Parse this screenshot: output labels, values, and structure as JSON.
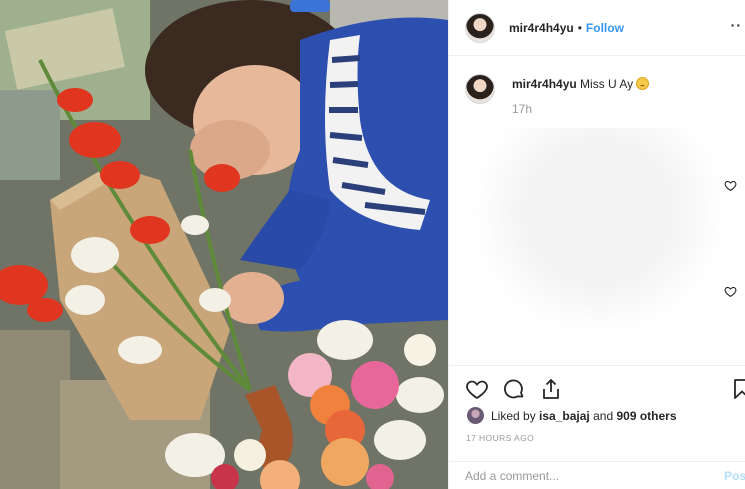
{
  "post": {
    "username": "mir4r4h4yu",
    "separator": "•",
    "follow_label": "Follow",
    "more_label": "··",
    "avatar_icon": "profile-avatar"
  },
  "comment": {
    "username": "mir4r4h4yu",
    "text": "Miss U Ay",
    "emoji_icon": "sad-face-emoji",
    "time": "17h"
  },
  "actions": {
    "like_icon": "heart-icon",
    "comment_icon": "comment-bubble-icon",
    "share_icon": "share-icon",
    "save_icon": "bookmark-icon",
    "liked_by_prefix": "Liked by ",
    "liked_by_user": "isa_bajaj",
    "liked_by_middle": " and ",
    "liked_by_count": "909 others",
    "timestamp": "17 HOURS AGO"
  },
  "composer": {
    "placeholder": "Add a comment...",
    "post_label": "Pos"
  },
  "colors": {
    "link_blue": "#3897f0",
    "post_disabled": "#b2dffc",
    "muted_text": "#999999",
    "divider": "#efefef"
  }
}
